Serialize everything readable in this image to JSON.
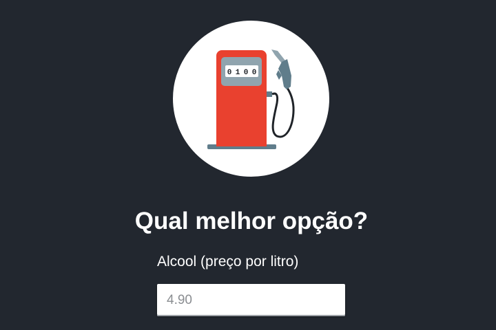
{
  "logo": {
    "icon": "fuel-pump-icon",
    "counter": [
      "0",
      "1",
      "0",
      "0"
    ],
    "colors": {
      "circle": "#ffffff",
      "pump_body": "#e9412f",
      "pump_shade": "#cf3424",
      "display": "#8fa3ad",
      "base": "#607d8b",
      "hose": "#1f2328",
      "nozzle": "#607d8b"
    }
  },
  "form": {
    "title": "Qual melhor opção?",
    "alcool_label": "Alcool (preço por litro)",
    "alcool_placeholder": "4.90"
  },
  "theme": {
    "background": "#22272f",
    "text": "#ffffff"
  }
}
